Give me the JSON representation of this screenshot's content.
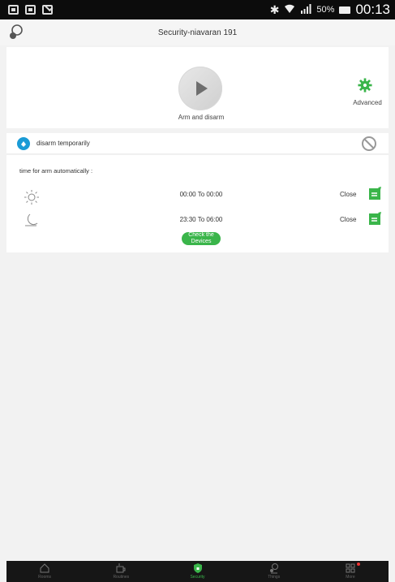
{
  "status_bar": {
    "battery_percent": "50%",
    "time": "00:13",
    "icons": [
      "image-icon",
      "gallery-icon",
      "mail-icon",
      "bluetooth-icon",
      "wifi-icon",
      "signal-icon",
      "battery-icon"
    ]
  },
  "header": {
    "title": "Security-niavaran 191",
    "icon": "user-silhouette-icon"
  },
  "arm_panel": {
    "arm_label": "Arm and disarm",
    "advanced_label": "Advanced",
    "accent_color": "#3ab54a"
  },
  "disarm_temp": {
    "label": "disarm temporarily",
    "icon_color": "#1a9bd6"
  },
  "schedule": {
    "title": "time for arm automatically :",
    "rows": [
      {
        "icon": "sun-icon",
        "time": "00:00 To 00:00",
        "status": "Close"
      },
      {
        "icon": "moon-icon",
        "time": "23:30 To 06:00",
        "status": "Close"
      }
    ],
    "check_button": "Check the Devices"
  },
  "tabs": [
    {
      "label": "Rooms",
      "icon": "home-icon",
      "active": false
    },
    {
      "label": "Routines",
      "icon": "coffee-icon",
      "active": false
    },
    {
      "label": "Security",
      "icon": "shield-icon",
      "active": true
    },
    {
      "label": "Things",
      "icon": "bell-icon",
      "active": false
    },
    {
      "label": "More",
      "icon": "grid-icon",
      "active": false
    }
  ]
}
